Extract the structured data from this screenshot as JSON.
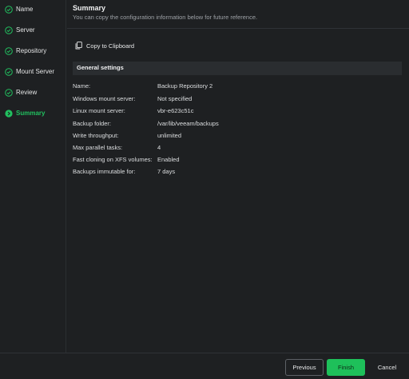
{
  "sidebar": {
    "steps": [
      {
        "label": "Name",
        "state": "completed"
      },
      {
        "label": "Server",
        "state": "completed"
      },
      {
        "label": "Repository",
        "state": "completed"
      },
      {
        "label": "Mount Server",
        "state": "completed"
      },
      {
        "label": "Review",
        "state": "completed"
      },
      {
        "label": "Summary",
        "state": "current"
      }
    ]
  },
  "header": {
    "title": "Summary",
    "subtitle": "You can copy the configuration information below for future reference."
  },
  "copy_button": {
    "label": "Copy to Clipboard",
    "icon": "clipboard-icon"
  },
  "section": {
    "title": "General settings",
    "rows": [
      {
        "key": "Name:",
        "value": "Backup Repository 2"
      },
      {
        "key": "Windows mount server:",
        "value": "Not specified"
      },
      {
        "key": "Linux mount server:",
        "value": "vbr-e623c51c"
      },
      {
        "key": "Backup folder:",
        "value": "/var/lib/veeam/backups"
      },
      {
        "key": "Write throughput:",
        "value": "unlimited"
      },
      {
        "key": "Max parallel tasks:",
        "value": "4"
      },
      {
        "key": "Fast cloning on XFS volumes:",
        "value": "Enabled"
      },
      {
        "key": "Backups immutable for:",
        "value": "7 days"
      }
    ]
  },
  "footer": {
    "previous_label": "Previous",
    "finish_label": "Finish",
    "cancel_label": "Cancel"
  },
  "colors": {
    "accent": "#1ec05a",
    "background": "#1e2022",
    "section_bar": "#2a2d30"
  }
}
